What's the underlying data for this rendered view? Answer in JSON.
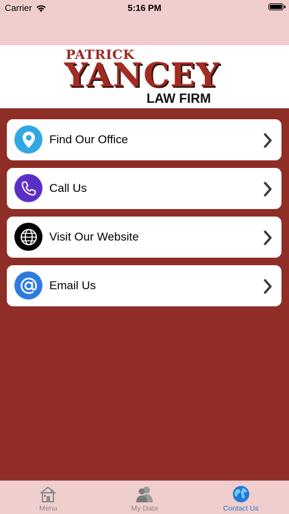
{
  "status_bar": {
    "carrier": "Carrier",
    "time": "5:16 PM"
  },
  "logo": {
    "line1": "PATRICK",
    "line2": "YANCEY",
    "line3": "LAW FIRM"
  },
  "menu": {
    "items": [
      {
        "label": "Find Our Office",
        "icon": "location-pin-icon",
        "color": "#2fa8e3"
      },
      {
        "label": "Call Us",
        "icon": "phone-icon",
        "color": "#5a2fc5"
      },
      {
        "label": "Visit Our Website",
        "icon": "globe-icon",
        "color": "#000000"
      },
      {
        "label": "Email Us",
        "icon": "at-sign-icon",
        "color": "#2d7be0"
      }
    ]
  },
  "tab_bar": {
    "tabs": [
      {
        "label": "Menu",
        "icon": "home-icon",
        "active": false
      },
      {
        "label": "My Data",
        "icon": "user-icon",
        "active": false
      },
      {
        "label": "Contact Us",
        "icon": "globe-icon",
        "active": true
      }
    ]
  },
  "colors": {
    "background": "#8e2e27",
    "header_band": "#f0cece",
    "active_tab": "#1f7bd6",
    "inactive_tab": "#8a8a8a"
  }
}
